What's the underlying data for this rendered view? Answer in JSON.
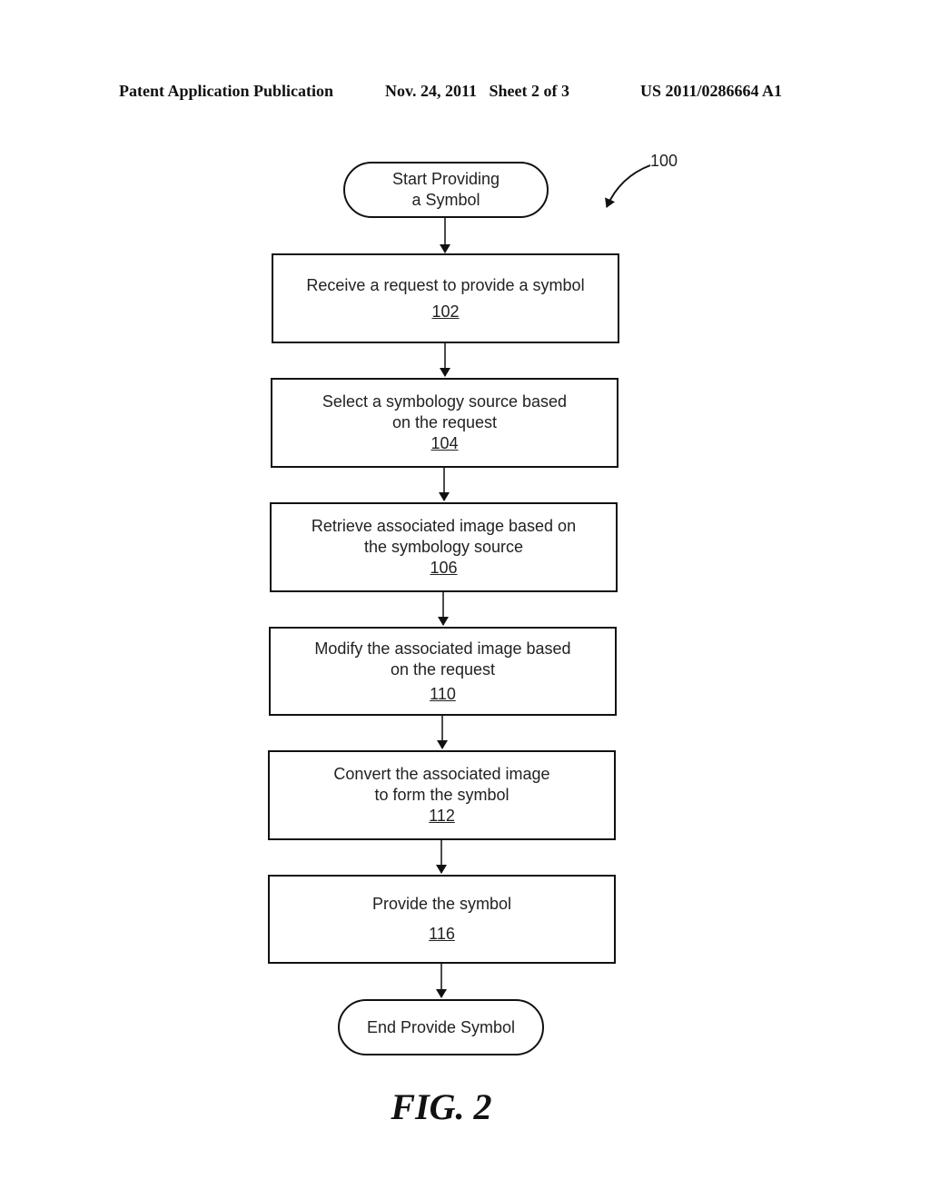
{
  "header": {
    "publication": "Patent Application Publication",
    "date_sheet": "Nov. 24, 2011   Sheet 2 of 3",
    "number": "US 2011/0286664 A1"
  },
  "diagram": {
    "ref_label": "100",
    "start": {
      "line1": "Start Providing",
      "line2": "a Symbol"
    },
    "steps": [
      {
        "line1": "Receive a request to provide a symbol",
        "line2": "",
        "ref": "102"
      },
      {
        "line1": "Select a symbology source based",
        "line2": "on the request",
        "ref": "104"
      },
      {
        "line1": "Retrieve associated image based on",
        "line2": "the symbology source",
        "ref": "106"
      },
      {
        "line1": "Modify the associated image based",
        "line2": "on the request",
        "ref": "110"
      },
      {
        "line1": "Convert the associated image",
        "line2": "to form the symbol",
        "ref": "112"
      },
      {
        "line1": "Provide the symbol",
        "line2": "",
        "ref": "116"
      }
    ],
    "end": {
      "label": "End Provide Symbol"
    },
    "figure_label": "FIG. 2"
  }
}
